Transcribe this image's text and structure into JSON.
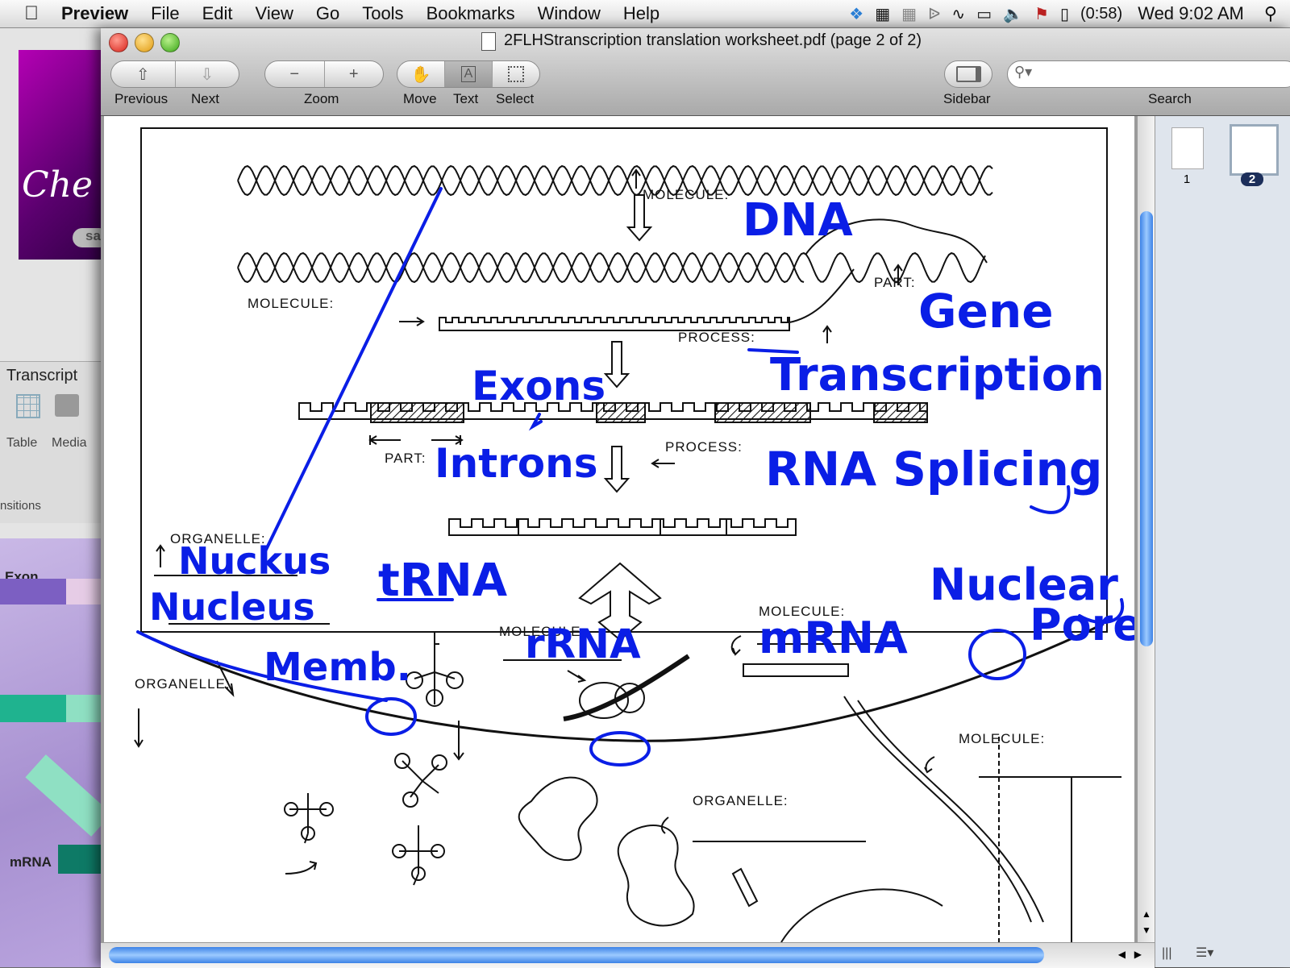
{
  "menubar": {
    "app": "Preview",
    "items": [
      "File",
      "Edit",
      "View",
      "Go",
      "Tools",
      "Bookmarks",
      "Window",
      "Help"
    ],
    "battery": "(0:58)",
    "clock": "Wed 9:02 AM"
  },
  "background": {
    "promo_text": "Che",
    "promo_small": "sa",
    "keynote_title": "Transcript",
    "table_label": "Table",
    "media_label": "Media",
    "transitions_label": "nsitions",
    "slide_exon": "Exon",
    "slide_mrna": "mRNA"
  },
  "window": {
    "title": "2FLHStranscription translation worksheet.pdf (page 2 of 2)",
    "toolbar": {
      "previous": "Previous",
      "next": "Next",
      "zoom": "Zoom",
      "move": "Move",
      "text": "Text",
      "select": "Select",
      "sidebar": "Sidebar",
      "search": "Search"
    },
    "search_value": "",
    "thumbnails": [
      "1",
      "2"
    ]
  },
  "worksheet": {
    "labels": {
      "molecule_top": "MOLECULE:",
      "molecule_left": "MOLECULE:",
      "part_right": "PART:",
      "process_1": "PROCESS:",
      "part_mid": "PART:",
      "process_2": "PROCESS:",
      "organelle_1": "ORGANELLE:",
      "organelle_2": "ORGANELLE:",
      "molecule_mid": "MOLECULE:",
      "molecule_right": "MOLECULE:",
      "molecule_lower": "MOLECULE:",
      "organelle_bottom": "ORGANELLE:"
    },
    "handwriting": {
      "dna": "DNA",
      "gene": "Gene",
      "transcription": "Transcription",
      "exons": "Exons",
      "introns": "Introns",
      "rna_splicing": "RNA Splicing",
      "nuckus": "Nuckus",
      "nucleus": "Nucleus",
      "trna": "tRNA",
      "nuclear": "Nuclear",
      "pores": "Pores",
      "memb": "Memb.",
      "rrna": "rRNA",
      "mrna": "mRNA"
    },
    "colors": {
      "ink": "#0a1ee6",
      "print": "#111111"
    }
  }
}
